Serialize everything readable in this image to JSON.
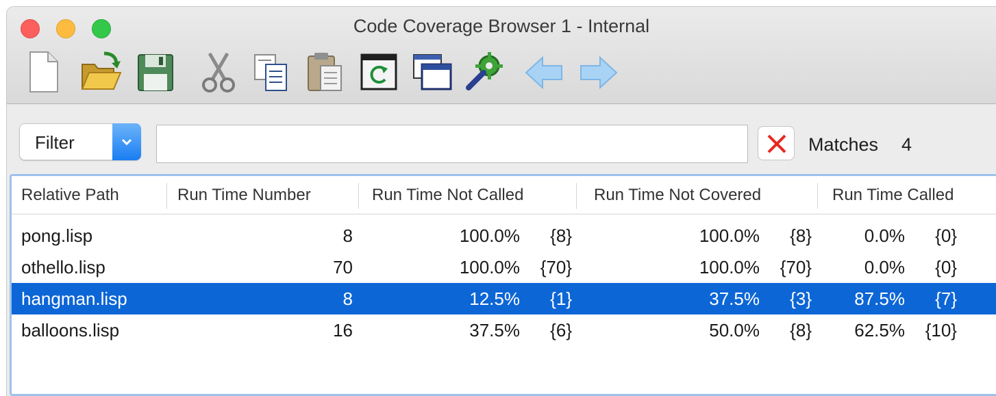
{
  "window": {
    "title": "Code Coverage Browser 1 - Internal"
  },
  "toolbar": {
    "buttons": [
      {
        "name": "new-document",
        "icon": "new-document-icon"
      },
      {
        "name": "open-folder",
        "icon": "open-folder-icon"
      },
      {
        "name": "save",
        "icon": "floppy-disk-icon"
      },
      {
        "name": "cut",
        "icon": "scissors-icon"
      },
      {
        "name": "copy",
        "icon": "copy-icon"
      },
      {
        "name": "paste",
        "icon": "clipboard-icon"
      },
      {
        "name": "refresh",
        "icon": "refresh-window-icon"
      },
      {
        "name": "windows",
        "icon": "windows-icon"
      },
      {
        "name": "tools",
        "icon": "gear-wrench-icon"
      },
      {
        "name": "back",
        "icon": "arrow-left-icon"
      },
      {
        "name": "forward",
        "icon": "arrow-right-icon"
      }
    ]
  },
  "filter": {
    "select_label": "Filter",
    "input_value": "",
    "matches_label": "Matches",
    "matches_count": "4"
  },
  "table": {
    "columns": [
      "Relative Path",
      "Run Time Number",
      "Run Time Not Called",
      "Run Time Not Covered",
      "Run Time Called"
    ],
    "rows": [
      {
        "path": "pong.lisp",
        "number": "8",
        "not_called_pct": "100.0%",
        "not_called_count": "{8}",
        "not_covered_pct": "100.0%",
        "not_covered_count": "{8}",
        "called_pct": "0.0%",
        "called_count": "{0}",
        "selected": false
      },
      {
        "path": "othello.lisp",
        "number": "70",
        "not_called_pct": "100.0%",
        "not_called_count": "{70}",
        "not_covered_pct": "100.0%",
        "not_covered_count": "{70}",
        "called_pct": "0.0%",
        "called_count": "{0}",
        "selected": false
      },
      {
        "path": "hangman.lisp",
        "number": "8",
        "not_called_pct": "12.5%",
        "not_called_count": "{1}",
        "not_covered_pct": "37.5%",
        "not_covered_count": "{3}",
        "called_pct": "87.5%",
        "called_count": "{7}",
        "selected": true
      },
      {
        "path": "balloons.lisp",
        "number": "16",
        "not_called_pct": "37.5%",
        "not_called_count": "{6}",
        "not_covered_pct": "50.0%",
        "not_covered_count": "{8}",
        "called_pct": "62.5%",
        "called_count": "{10}",
        "selected": false
      }
    ]
  },
  "colors": {
    "selection": "#0d66d6",
    "accent": "#1a7ef2",
    "clear_x": "#e8281e"
  }
}
